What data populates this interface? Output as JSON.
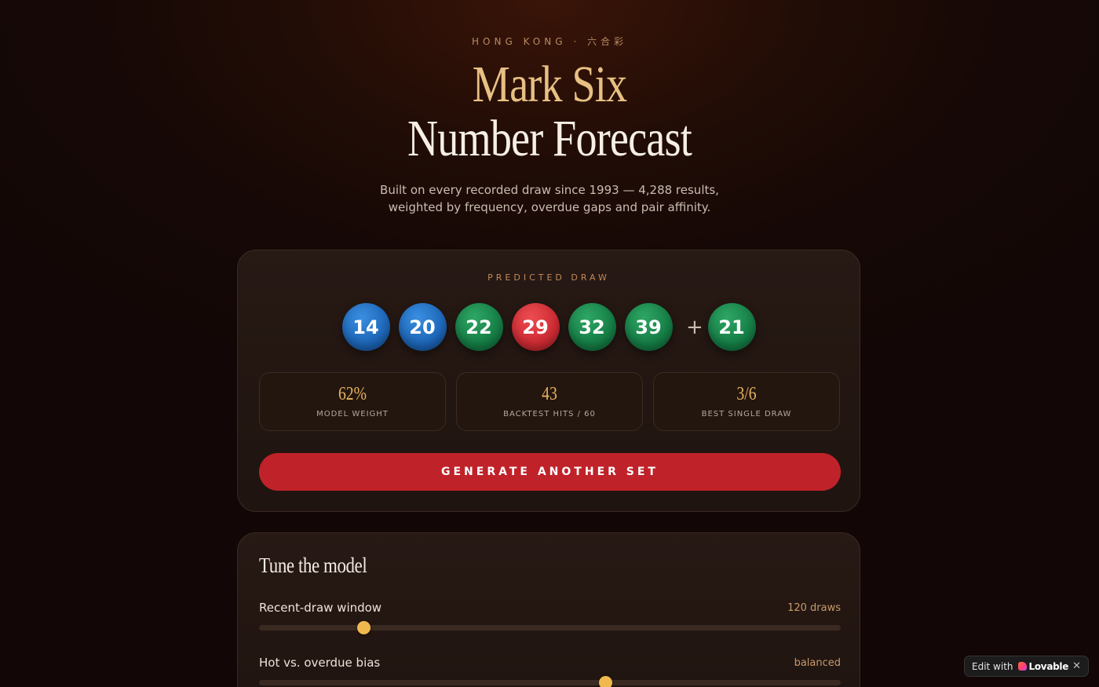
{
  "header": {
    "eyebrow": "HONG KONG · 六合彩",
    "title_line1": "Mark Six",
    "title_line2": "Number Forecast",
    "subtitle_line1": "Built on every recorded draw since 1993 — 4,288 results,",
    "subtitle_line2": "weighted by frequency, overdue gaps and pair affinity."
  },
  "prediction": {
    "label": "PREDICTED DRAW",
    "balls": [
      {
        "number": "14",
        "color": "blue"
      },
      {
        "number": "20",
        "color": "blue"
      },
      {
        "number": "22",
        "color": "green"
      },
      {
        "number": "29",
        "color": "red"
      },
      {
        "number": "32",
        "color": "green"
      },
      {
        "number": "39",
        "color": "green"
      }
    ],
    "plus": "+",
    "extra_ball": {
      "number": "21",
      "color": "green"
    },
    "stats": [
      {
        "value": "62%",
        "label": "MODEL WEIGHT"
      },
      {
        "value": "43",
        "label": "BACKTEST HITS / 60"
      },
      {
        "value": "3/6",
        "label": "BEST SINGLE DRAW"
      }
    ],
    "generate_button": "GENERATE ANOTHER SET"
  },
  "tune": {
    "title": "Tune the model",
    "sliders": [
      {
        "label": "Recent-draw window",
        "value_text": "120 draws",
        "level": 0.18
      },
      {
        "label": "Hot vs. overdue bias",
        "value_text": "balanced",
        "level": 0.595
      }
    ]
  },
  "badge": {
    "edit_text": "Edit with",
    "brand": "Lovable",
    "close": "✕"
  },
  "colors": {
    "accent_gold": "#e7c083",
    "button_red": "#c0222a",
    "ball_blue": "#1d66b8",
    "ball_green": "#157d45",
    "ball_red": "#cc2b33",
    "slider_thumb": "#efb94d"
  }
}
